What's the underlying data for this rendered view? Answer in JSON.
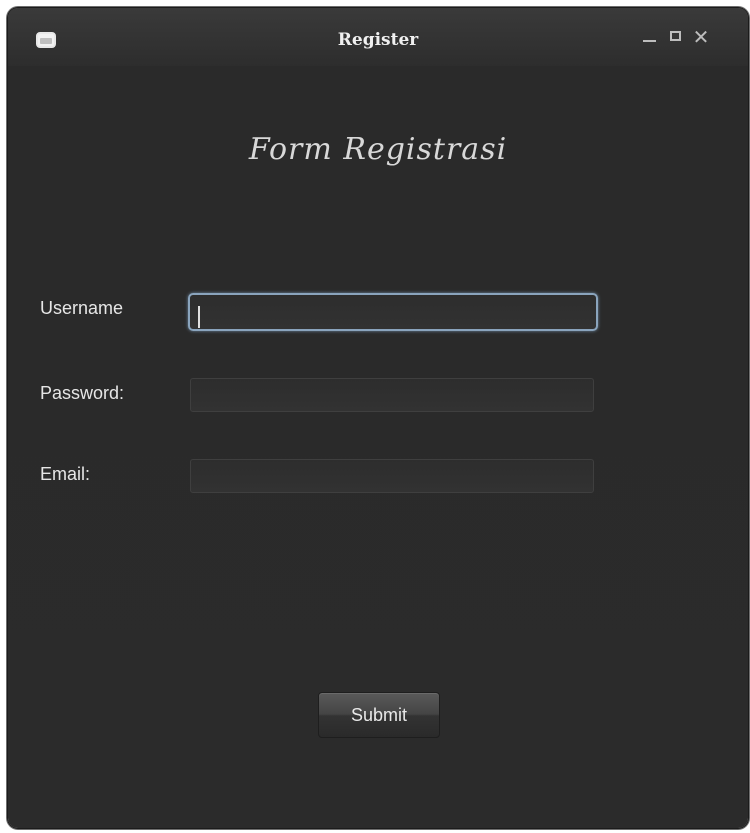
{
  "window": {
    "title": "Register"
  },
  "form": {
    "heading": "Form Registrasi",
    "fields": [
      {
        "label": "Username",
        "value": "",
        "placeholder": ""
      },
      {
        "label": "Password:",
        "value": "",
        "placeholder": ""
      },
      {
        "label": "Email:",
        "value": "",
        "placeholder": ""
      }
    ],
    "submit_label": "Submit"
  },
  "icons": {
    "app": "window-app-icon",
    "minimize": "minimize-icon",
    "maximize": "maximize-icon",
    "close": "close-icon"
  },
  "colors": {
    "background": "#2b2b2b",
    "focus_border": "#8aa4bd",
    "text": "#e6e6e6"
  }
}
